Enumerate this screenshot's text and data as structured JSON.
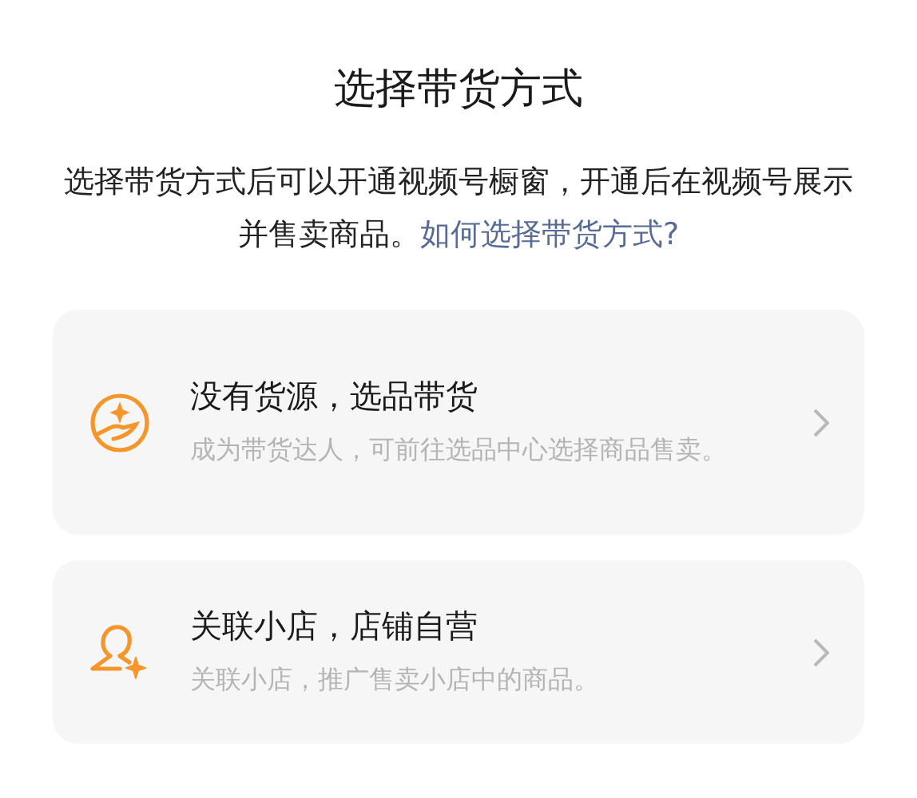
{
  "title": "选择带货方式",
  "description": {
    "text": "选择带货方式后可以开通视频号橱窗，开通后在视频号展示并售卖商品。",
    "link": "如何选择带货方式?"
  },
  "options": [
    {
      "kind": "select",
      "title": "没有货源，选品带货",
      "subtitle": "成为带货达人，可前往选品中心选择商品售卖。"
    },
    {
      "kind": "shop",
      "title": "关联小店，店铺自营",
      "subtitle": "关联小店，推广售卖小店中的商品。"
    }
  ]
}
